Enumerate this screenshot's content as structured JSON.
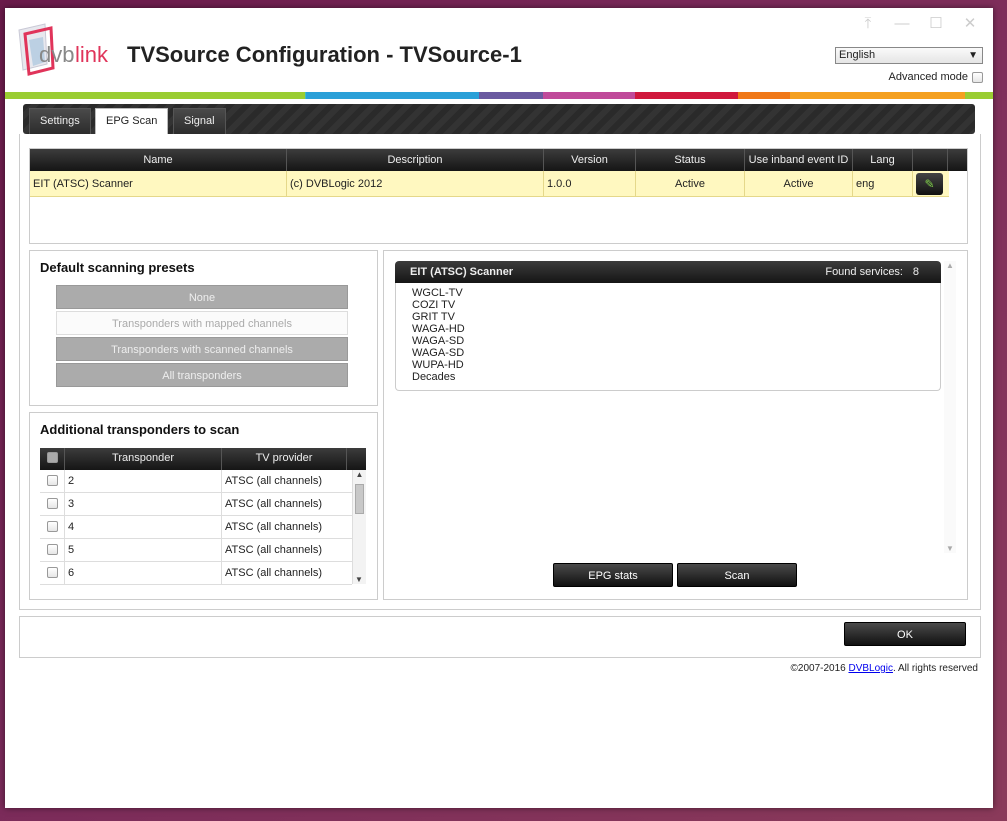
{
  "header": {
    "logo_text": "dvblink",
    "title": "TVSource Configuration - TVSource-1",
    "language": "English",
    "advanced_mode_label": "Advanced mode"
  },
  "color_bar": [
    "#9acd32",
    "#3fbfbf",
    "#2aa0d8",
    "#6a5aa0",
    "#c04a9a",
    "#d0183c",
    "#f07818",
    "#f4a020",
    "#9acd32"
  ],
  "tabs": [
    "Settings",
    "EPG Scan",
    "Signal"
  ],
  "active_tab": "EPG Scan",
  "scanner_table": {
    "columns": [
      "Name",
      "Description",
      "Version",
      "Status",
      "Use inband event ID",
      "Lang"
    ],
    "rows": [
      {
        "name": "EIT (ATSC) Scanner",
        "description": "(c) DVBLogic 2012",
        "version": "1.0.0",
        "status": "Active",
        "inband": "Active",
        "lang": "eng"
      }
    ]
  },
  "presets": {
    "title": "Default scanning presets",
    "options": [
      "None",
      "Transponders with mapped channels",
      "Transponders with scanned channels",
      "All transponders"
    ],
    "selected": "Transponders with mapped channels"
  },
  "transponders": {
    "title": "Additional transponders to scan",
    "columns": [
      "Transponder",
      "TV provider"
    ],
    "rows": [
      {
        "transponder": "2",
        "provider": "ATSC (all channels)"
      },
      {
        "transponder": "3",
        "provider": "ATSC (all channels)"
      },
      {
        "transponder": "4",
        "provider": "ATSC (all channels)"
      },
      {
        "transponder": "5",
        "provider": "ATSC (all channels)"
      },
      {
        "transponder": "6",
        "provider": "ATSC (all channels)"
      }
    ]
  },
  "services": {
    "scanner_name": "EIT (ATSC) Scanner",
    "found_label": "Found services:",
    "found_count": "8",
    "items": [
      "WGCL-TV",
      "COZI TV",
      "GRIT TV",
      "WAGA-HD",
      "WAGA-SD",
      "WAGA-SD",
      "WUPA-HD",
      "Decades"
    ]
  },
  "buttons": {
    "epg_stats": "EPG stats",
    "scan": "Scan",
    "ok": "OK"
  },
  "footer": {
    "copyright": "©2007-2016 ",
    "link": "DVBLogic",
    "suffix": ". All rights reserved"
  }
}
